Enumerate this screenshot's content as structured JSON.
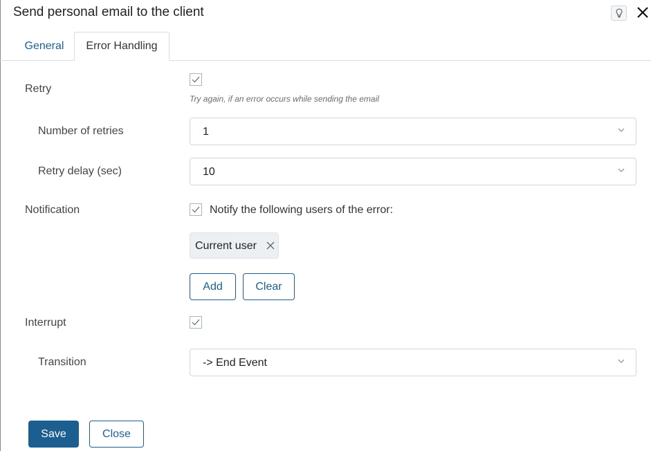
{
  "dialog": {
    "title": "Send personal email to the client",
    "help_icon": "help-bulb-icon",
    "close_icon": "close-icon"
  },
  "tabs": [
    {
      "label": "General",
      "active": false
    },
    {
      "label": "Error Handling",
      "active": true
    }
  ],
  "retry": {
    "label": "Retry",
    "checked": true,
    "hint": "Try again, if an error occurs while sending the email"
  },
  "number_of_retries": {
    "label": "Number of retries",
    "value": "1"
  },
  "retry_delay": {
    "label": "Retry delay (sec)",
    "value": "10"
  },
  "notification": {
    "label": "Notification",
    "checked": true,
    "checkbox_label": "Notify the following users of the error:",
    "users": [
      {
        "name": "Current user"
      }
    ],
    "add_label": "Add",
    "clear_label": "Clear"
  },
  "interrupt": {
    "label": "Interrupt",
    "checked": true
  },
  "transition": {
    "label": "Transition",
    "value": "-> End Event"
  },
  "footer": {
    "save_label": "Save",
    "close_label": "Close"
  },
  "colors": {
    "accent": "#1b5e8f",
    "border": "#cfd6dd"
  }
}
